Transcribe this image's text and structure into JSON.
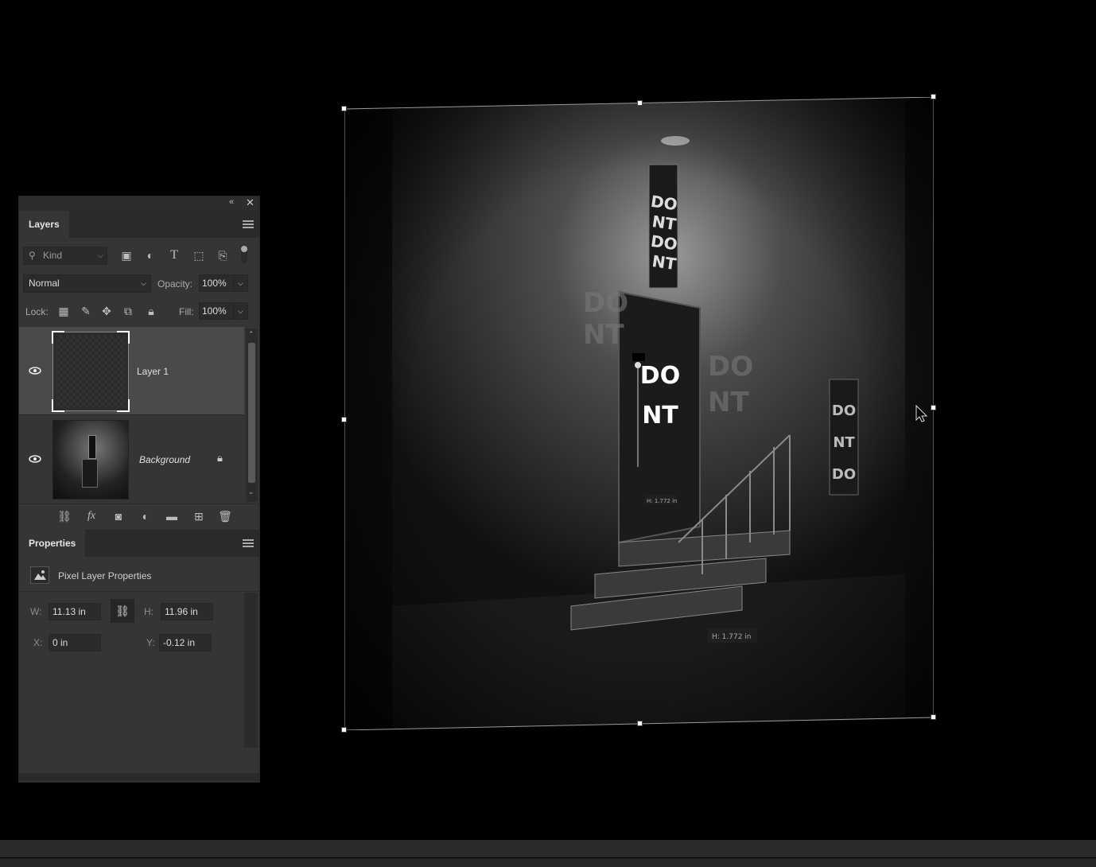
{
  "layers_panel": {
    "tab": "Layers",
    "filter": {
      "kind_placeholder": "Kind"
    },
    "blend_mode": "Normal",
    "opacity_label": "Opacity:",
    "opacity_value": "100%",
    "lock_label": "Lock:",
    "fill_label": "Fill:",
    "fill_value": "100%",
    "layers": [
      {
        "name": "Layer 1",
        "visible": true,
        "selected": true
      },
      {
        "name": "Background",
        "visible": true,
        "locked": true
      }
    ],
    "footer_icons": [
      "link-icon",
      "fx-icon",
      "mask-icon",
      "adjustment-icon",
      "folder-icon",
      "new-layer-icon",
      "trash-icon"
    ]
  },
  "properties_panel": {
    "tab": "Properties",
    "title": "Pixel Layer Properties",
    "w_label": "W:",
    "w_value": "11.13 in",
    "h_label": "H:",
    "h_value": "11.96 in",
    "x_label": "X:",
    "x_value": "0 in",
    "y_label": "Y:",
    "y_value": "-0.12 in"
  },
  "canvas": {
    "sign_text_1": "DO NT",
    "sign_text_2": "DO NT",
    "door_text": "DO NT",
    "dim_readout_1": "H: 1.772 in",
    "dim_readout_2": "H: 1.772 in"
  }
}
